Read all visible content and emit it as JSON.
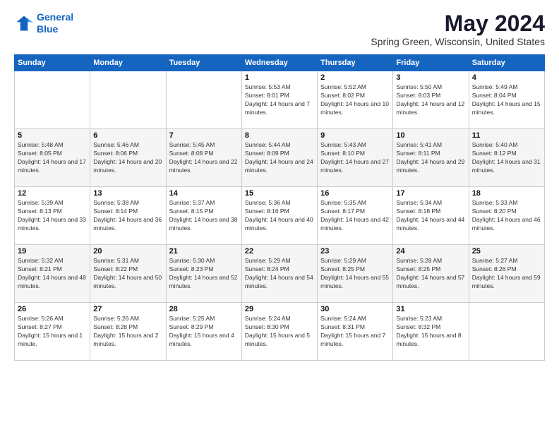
{
  "header": {
    "logo_line1": "General",
    "logo_line2": "Blue",
    "month": "May 2024",
    "location": "Spring Green, Wisconsin, United States"
  },
  "weekdays": [
    "Sunday",
    "Monday",
    "Tuesday",
    "Wednesday",
    "Thursday",
    "Friday",
    "Saturday"
  ],
  "weeks": [
    [
      null,
      null,
      null,
      {
        "day": "1",
        "sunrise": "Sunrise: 5:53 AM",
        "sunset": "Sunset: 8:01 PM",
        "daylight": "Daylight: 14 hours and 7 minutes."
      },
      {
        "day": "2",
        "sunrise": "Sunrise: 5:52 AM",
        "sunset": "Sunset: 8:02 PM",
        "daylight": "Daylight: 14 hours and 10 minutes."
      },
      {
        "day": "3",
        "sunrise": "Sunrise: 5:50 AM",
        "sunset": "Sunset: 8:03 PM",
        "daylight": "Daylight: 14 hours and 12 minutes."
      },
      {
        "day": "4",
        "sunrise": "Sunrise: 5:49 AM",
        "sunset": "Sunset: 8:04 PM",
        "daylight": "Daylight: 14 hours and 15 minutes."
      }
    ],
    [
      {
        "day": "5",
        "sunrise": "Sunrise: 5:48 AM",
        "sunset": "Sunset: 8:05 PM",
        "daylight": "Daylight: 14 hours and 17 minutes."
      },
      {
        "day": "6",
        "sunrise": "Sunrise: 5:46 AM",
        "sunset": "Sunset: 8:06 PM",
        "daylight": "Daylight: 14 hours and 20 minutes."
      },
      {
        "day": "7",
        "sunrise": "Sunrise: 5:45 AM",
        "sunset": "Sunset: 8:08 PM",
        "daylight": "Daylight: 14 hours and 22 minutes."
      },
      {
        "day": "8",
        "sunrise": "Sunrise: 5:44 AM",
        "sunset": "Sunset: 8:09 PM",
        "daylight": "Daylight: 14 hours and 24 minutes."
      },
      {
        "day": "9",
        "sunrise": "Sunrise: 5:43 AM",
        "sunset": "Sunset: 8:10 PM",
        "daylight": "Daylight: 14 hours and 27 minutes."
      },
      {
        "day": "10",
        "sunrise": "Sunrise: 5:41 AM",
        "sunset": "Sunset: 8:11 PM",
        "daylight": "Daylight: 14 hours and 29 minutes."
      },
      {
        "day": "11",
        "sunrise": "Sunrise: 5:40 AM",
        "sunset": "Sunset: 8:12 PM",
        "daylight": "Daylight: 14 hours and 31 minutes."
      }
    ],
    [
      {
        "day": "12",
        "sunrise": "Sunrise: 5:39 AM",
        "sunset": "Sunset: 8:13 PM",
        "daylight": "Daylight: 14 hours and 33 minutes."
      },
      {
        "day": "13",
        "sunrise": "Sunrise: 5:38 AM",
        "sunset": "Sunset: 8:14 PM",
        "daylight": "Daylight: 14 hours and 36 minutes."
      },
      {
        "day": "14",
        "sunrise": "Sunrise: 5:37 AM",
        "sunset": "Sunset: 8:15 PM",
        "daylight": "Daylight: 14 hours and 38 minutes."
      },
      {
        "day": "15",
        "sunrise": "Sunrise: 5:36 AM",
        "sunset": "Sunset: 8:16 PM",
        "daylight": "Daylight: 14 hours and 40 minutes."
      },
      {
        "day": "16",
        "sunrise": "Sunrise: 5:35 AM",
        "sunset": "Sunset: 8:17 PM",
        "daylight": "Daylight: 14 hours and 42 minutes."
      },
      {
        "day": "17",
        "sunrise": "Sunrise: 5:34 AM",
        "sunset": "Sunset: 8:18 PM",
        "daylight": "Daylight: 14 hours and 44 minutes."
      },
      {
        "day": "18",
        "sunrise": "Sunrise: 5:33 AM",
        "sunset": "Sunset: 8:20 PM",
        "daylight": "Daylight: 14 hours and 46 minutes."
      }
    ],
    [
      {
        "day": "19",
        "sunrise": "Sunrise: 5:32 AM",
        "sunset": "Sunset: 8:21 PM",
        "daylight": "Daylight: 14 hours and 48 minutes."
      },
      {
        "day": "20",
        "sunrise": "Sunrise: 5:31 AM",
        "sunset": "Sunset: 8:22 PM",
        "daylight": "Daylight: 14 hours and 50 minutes."
      },
      {
        "day": "21",
        "sunrise": "Sunrise: 5:30 AM",
        "sunset": "Sunset: 8:23 PM",
        "daylight": "Daylight: 14 hours and 52 minutes."
      },
      {
        "day": "22",
        "sunrise": "Sunrise: 5:29 AM",
        "sunset": "Sunset: 8:24 PM",
        "daylight": "Daylight: 14 hours and 54 minutes."
      },
      {
        "day": "23",
        "sunrise": "Sunrise: 5:29 AM",
        "sunset": "Sunset: 8:25 PM",
        "daylight": "Daylight: 14 hours and 55 minutes."
      },
      {
        "day": "24",
        "sunrise": "Sunrise: 5:28 AM",
        "sunset": "Sunset: 8:25 PM",
        "daylight": "Daylight: 14 hours and 57 minutes."
      },
      {
        "day": "25",
        "sunrise": "Sunrise: 5:27 AM",
        "sunset": "Sunset: 8:26 PM",
        "daylight": "Daylight: 14 hours and 59 minutes."
      }
    ],
    [
      {
        "day": "26",
        "sunrise": "Sunrise: 5:26 AM",
        "sunset": "Sunset: 8:27 PM",
        "daylight": "Daylight: 15 hours and 1 minute."
      },
      {
        "day": "27",
        "sunrise": "Sunrise: 5:26 AM",
        "sunset": "Sunset: 8:28 PM",
        "daylight": "Daylight: 15 hours and 2 minutes."
      },
      {
        "day": "28",
        "sunrise": "Sunrise: 5:25 AM",
        "sunset": "Sunset: 8:29 PM",
        "daylight": "Daylight: 15 hours and 4 minutes."
      },
      {
        "day": "29",
        "sunrise": "Sunrise: 5:24 AM",
        "sunset": "Sunset: 8:30 PM",
        "daylight": "Daylight: 15 hours and 5 minutes."
      },
      {
        "day": "30",
        "sunrise": "Sunrise: 5:24 AM",
        "sunset": "Sunset: 8:31 PM",
        "daylight": "Daylight: 15 hours and 7 minutes."
      },
      {
        "day": "31",
        "sunrise": "Sunrise: 5:23 AM",
        "sunset": "Sunset: 8:32 PM",
        "daylight": "Daylight: 15 hours and 8 minutes."
      },
      null
    ]
  ]
}
